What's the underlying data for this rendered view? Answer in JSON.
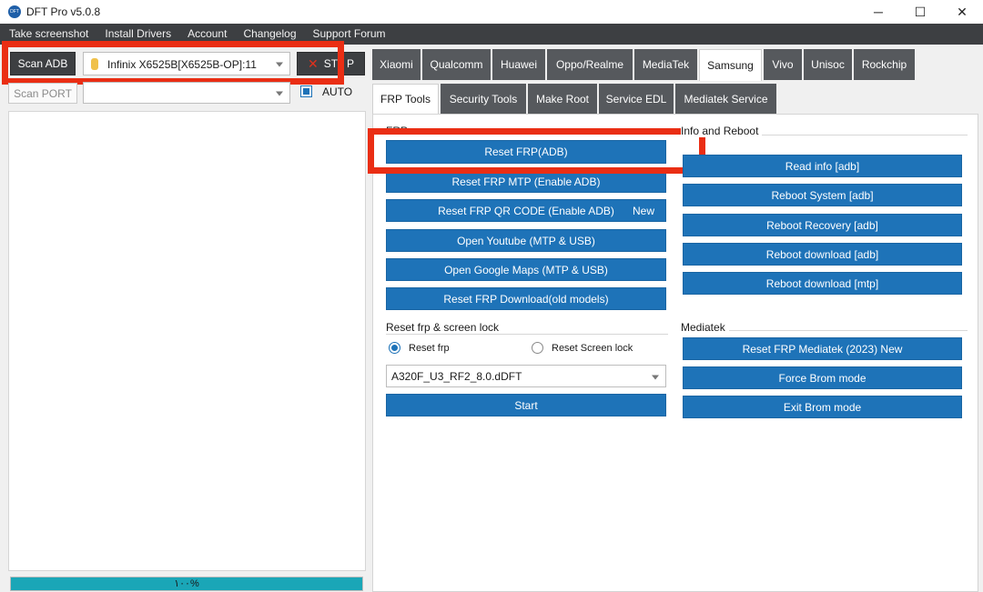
{
  "window": {
    "title": "DFT Pro v5.0.8",
    "minimize": "─",
    "maximize": "☐",
    "close": "✕"
  },
  "menu": [
    "Take screenshot",
    "Install Drivers",
    "Account",
    "Changelog",
    "Support Forum"
  ],
  "left": {
    "scan_adb": "Scan ADB",
    "device": "Infinix X6525B[X6525B-OP]:11",
    "stop_label_a": "ST",
    "stop_label_b": "P",
    "scan_port": "Scan PORT",
    "port_value": "",
    "auto_label": "AUTO",
    "auto_checked": true,
    "progress_text": "١٠٠%",
    "progress_percent": 100
  },
  "brand_tabs": [
    "Xiaomi",
    "Qualcomm",
    "Huawei",
    "Oppo/Realme",
    "MediaTek",
    "Samsung",
    "Vivo",
    "Unisoc",
    "Rockchip"
  ],
  "active_brand": "Samsung",
  "sub_tabs": [
    "FRP Tools",
    "Security Tools",
    "Make Root",
    "Service EDL",
    "Mediatek Service"
  ],
  "active_sub_tab": "FRP Tools",
  "frp": {
    "group_label": "FRP",
    "buttons": [
      "Reset FRP(ADB)",
      "Reset FRP MTP (Enable ADB)",
      "Reset FRP QR CODE (Enable ADB)",
      "Open Youtube (MTP & USB)",
      "Open Google Maps (MTP & USB)",
      "Reset FRP Download(old models)"
    ],
    "new_tag": "New"
  },
  "reset_lock": {
    "group_label": "Reset frp & screen lock",
    "radio_frp": "Reset frp",
    "radio_screen": "Reset Screen lock",
    "selected": "Reset frp",
    "firmware": "A320F_U3_RF2_8.0.dDFT",
    "start": "Start"
  },
  "info_reboot": {
    "group_label": "Info and Reboot",
    "buttons": [
      "Read info [adb]",
      "Reboot System [adb]",
      "Reboot Recovery [adb]",
      "Reboot download [adb]",
      "Reboot download [mtp]"
    ]
  },
  "mediatek": {
    "group_label": "Mediatek",
    "buttons": [
      "Reset FRP Mediatek (2023) New",
      "Force Brom mode",
      "Exit Brom mode"
    ]
  },
  "colors": {
    "accent": "#1e73b8",
    "highlight": "#ea2e14",
    "tab_dark": "#56595d",
    "menubar": "#3d3f42",
    "progress": "#1aa6b7"
  }
}
